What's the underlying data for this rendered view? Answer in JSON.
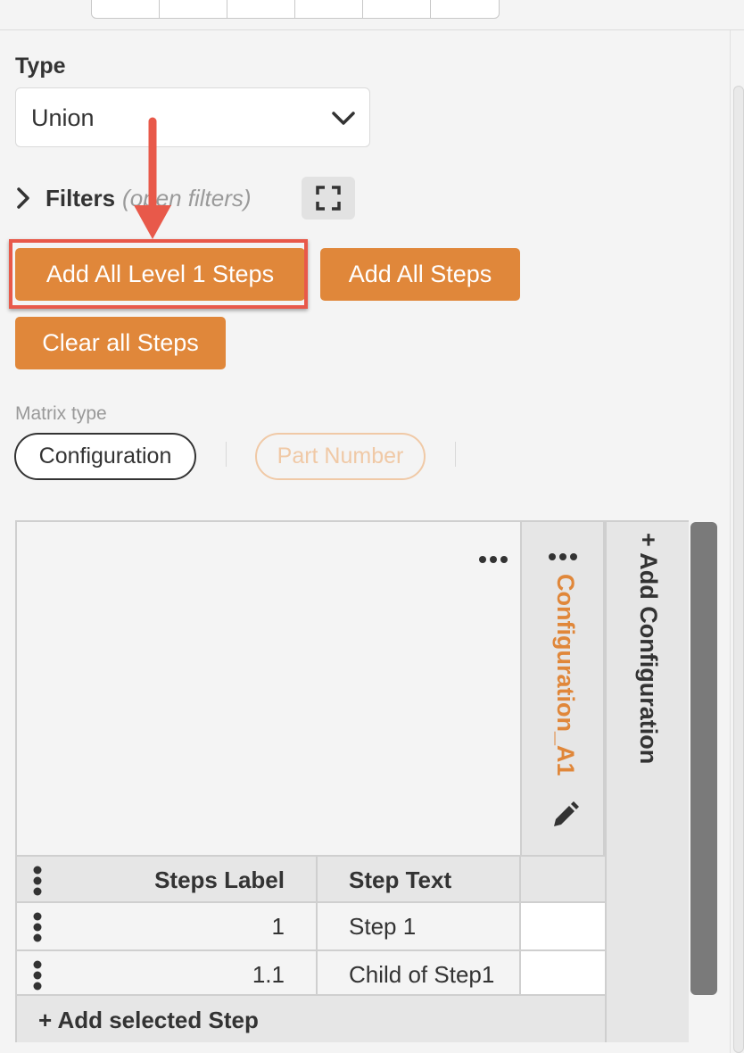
{
  "type_field": {
    "label": "Type",
    "value": "Union"
  },
  "filters": {
    "label": "Filters",
    "hint": "(open filters)"
  },
  "actions": {
    "add_level1": "Add All Level 1 Steps",
    "add_all": "Add All Steps",
    "clear_all": "Clear all Steps"
  },
  "matrix_type": {
    "label": "Matrix type",
    "options": [
      "Configuration",
      "Part Number"
    ],
    "selected": "Configuration"
  },
  "matrix": {
    "configuration_column": "Configuration_A1",
    "add_configuration": "+ Add Configuration",
    "columns": [
      "Steps Label",
      "Step Text"
    ],
    "rows": [
      {
        "label": "1",
        "text": "Step 1"
      },
      {
        "label": "1.1",
        "text": "Child of Step1"
      }
    ],
    "add_step": "+ Add selected Step"
  },
  "colors": {
    "accent": "#e0873a",
    "highlight": "#e8594a"
  }
}
